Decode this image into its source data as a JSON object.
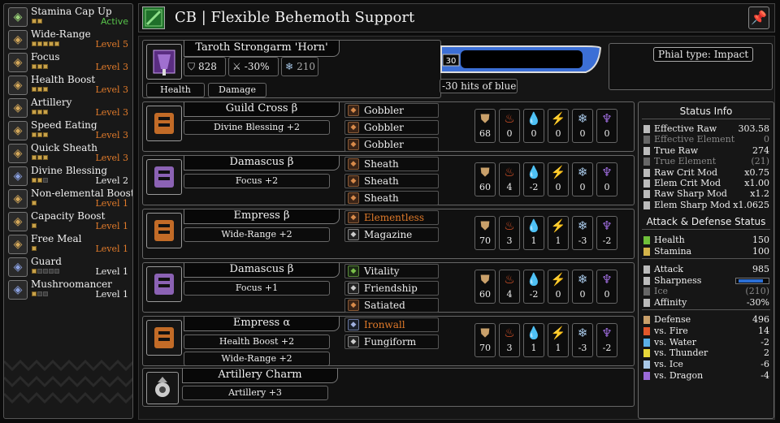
{
  "header": {
    "title": "CB | Flexible Behemoth Support",
    "pin_icon": "pin-icon"
  },
  "skills": [
    {
      "name": "Stamina Cap Up",
      "level": "Active",
      "pips": 2,
      "max": 2,
      "color": "green",
      "icon": "stamina-icon"
    },
    {
      "name": "Wide-Range",
      "level": "Level 5",
      "pips": 5,
      "max": 5,
      "color": "orange",
      "icon": "wide-range-icon"
    },
    {
      "name": "Focus",
      "level": "Level 3",
      "pips": 3,
      "max": 3,
      "color": "orange",
      "icon": "focus-icon"
    },
    {
      "name": "Health Boost",
      "level": "Level 3",
      "pips": 3,
      "max": 3,
      "color": "orange",
      "icon": "health-boost-icon"
    },
    {
      "name": "Artillery",
      "level": "Level 3",
      "pips": 3,
      "max": 3,
      "color": "orange",
      "icon": "artillery-icon"
    },
    {
      "name": "Speed Eating",
      "level": "Level 3",
      "pips": 3,
      "max": 3,
      "color": "orange",
      "icon": "speed-eating-icon"
    },
    {
      "name": "Quick Sheath",
      "level": "Level 3",
      "pips": 3,
      "max": 3,
      "color": "orange",
      "icon": "quick-sheath-icon"
    },
    {
      "name": "Divine Blessing",
      "level": "Level 2",
      "pips": 2,
      "max": 3,
      "color": "white",
      "icon": "divine-blessing-icon"
    },
    {
      "name": "Non-elemental Boost",
      "level": "Level 1",
      "pips": 1,
      "max": 1,
      "color": "orange",
      "icon": "non-elemental-boost-icon"
    },
    {
      "name": "Capacity Boost",
      "level": "Level 1",
      "pips": 1,
      "max": 1,
      "color": "orange",
      "icon": "capacity-boost-icon"
    },
    {
      "name": "Free Meal",
      "level": "Level 1",
      "pips": 1,
      "max": 1,
      "color": "orange",
      "icon": "free-meal-icon"
    },
    {
      "name": "Guard",
      "level": "Level 1",
      "pips": 1,
      "max": 5,
      "color": "white",
      "icon": "guard-icon"
    },
    {
      "name": "Mushroomancer",
      "level": "Level 1",
      "pips": 1,
      "max": 3,
      "color": "white",
      "icon": "mushroomancer-icon"
    }
  ],
  "weapon": {
    "name": "Taroth Strongarm 'Horn'",
    "attack": "828",
    "affinity": "-30%",
    "element": "210",
    "buttons": {
      "health": "Health",
      "damage": "Damage"
    },
    "sharpness_level": "30",
    "hits_label": "-30 hits of blue",
    "phial": "Phial type: Impact",
    "sharpness_color": "#2b6fd6"
  },
  "armor": [
    {
      "name": "Guild Cross β",
      "skills": [
        "Divine Blessing +2"
      ],
      "decos": [
        {
          "label": "Gobbler",
          "tone": "orange",
          "highlight": false
        },
        {
          "label": "Gobbler",
          "tone": "orange",
          "highlight": false
        },
        {
          "label": "Gobbler",
          "tone": "orange",
          "highlight": false
        }
      ],
      "res": [
        "68",
        "0",
        "0",
        "0",
        "0",
        "0"
      ]
    },
    {
      "name": "Damascus β",
      "skills": [
        "Focus +2"
      ],
      "decos": [
        {
          "label": "Sheath",
          "tone": "orange",
          "highlight": false
        },
        {
          "label": "Sheath",
          "tone": "orange",
          "highlight": false
        },
        {
          "label": "Sheath",
          "tone": "orange",
          "highlight": false
        }
      ],
      "res": [
        "60",
        "4",
        "-2",
        "0",
        "0",
        "0"
      ]
    },
    {
      "name": "Empress β",
      "skills": [
        "Wide-Range +2"
      ],
      "decos": [
        {
          "label": "Elementless",
          "tone": "orange",
          "highlight": true
        },
        {
          "label": "Magazine",
          "tone": "grey",
          "highlight": false
        }
      ],
      "res": [
        "70",
        "3",
        "1",
        "1",
        "-3",
        "-2"
      ]
    },
    {
      "name": "Damascus β",
      "skills": [
        "Focus +1"
      ],
      "decos": [
        {
          "label": "Vitality",
          "tone": "green",
          "highlight": false
        },
        {
          "label": "Friendship",
          "tone": "grey",
          "highlight": false
        },
        {
          "label": "Satiated",
          "tone": "orange",
          "highlight": false
        }
      ],
      "res": [
        "60",
        "4",
        "-2",
        "0",
        "0",
        "0"
      ]
    },
    {
      "name": "Empress α",
      "skills": [
        "Health Boost +2",
        "Wide-Range +2"
      ],
      "decos": [
        {
          "label": "Ironwall",
          "tone": "blue",
          "highlight": true
        },
        {
          "label": "Fungiform",
          "tone": "grey",
          "highlight": false
        }
      ],
      "res": [
        "70",
        "3",
        "1",
        "1",
        "-3",
        "-2"
      ]
    }
  ],
  "charm": {
    "name": "Artillery Charm",
    "skills": [
      "Artillery +3"
    ]
  },
  "status": {
    "title": "Status Info",
    "rows": [
      {
        "label": "Effective Raw",
        "value": "303.58",
        "dim": false
      },
      {
        "label": "Effective Element",
        "value": "0",
        "dim": true
      },
      {
        "label": "True Raw",
        "value": "274",
        "dim": false
      },
      {
        "label": "True Element",
        "value": "(21)",
        "dim": true
      },
      {
        "label": "Raw Crit Mod",
        "value": "x0.75",
        "dim": false
      },
      {
        "label": "Elem Crit Mod",
        "value": "x1.00",
        "dim": false
      },
      {
        "label": "Raw Sharp Mod",
        "value": "x1.2",
        "dim": false
      },
      {
        "label": "Elem Sharp Mod",
        "value": "x1.0625",
        "dim": false
      }
    ],
    "ad_title": "Attack & Defense Status",
    "vitals": [
      {
        "label": "Health",
        "value": "150",
        "color": "#6fbf3a"
      },
      {
        "label": "Stamina",
        "value": "100",
        "color": "#d4b44a"
      }
    ],
    "attack_rows": [
      {
        "label": "Attack",
        "value": "985",
        "dim": false
      },
      {
        "label": "Sharpness",
        "value": "",
        "dim": false
      },
      {
        "label": "Ice",
        "value": "(210)",
        "dim": true
      },
      {
        "label": "Affinity",
        "value": "-30%",
        "dim": false
      }
    ],
    "defense_rows": [
      {
        "label": "Defense",
        "value": "496",
        "color": "#c9a06a"
      },
      {
        "label": "vs. Fire",
        "value": "14",
        "color": "#e2572a"
      },
      {
        "label": "vs. Water",
        "value": "-2",
        "color": "#5ab0e8"
      },
      {
        "label": "vs. Thunder",
        "value": "2",
        "color": "#e8d83a"
      },
      {
        "label": "vs. Ice",
        "value": "-6",
        "color": "#a8c8e8"
      },
      {
        "label": "vs. Dragon",
        "value": "-4",
        "color": "#9a6ad8"
      }
    ]
  },
  "res_icons": [
    {
      "name": "defense-icon",
      "glyph": "⛊",
      "color": "#c9a06a"
    },
    {
      "name": "fire-icon",
      "glyph": "♨",
      "color": "#e2572a"
    },
    {
      "name": "water-icon",
      "glyph": "💧",
      "color": "#5ab0e8"
    },
    {
      "name": "thunder-icon",
      "glyph": "⚡",
      "color": "#e8d83a"
    },
    {
      "name": "ice-icon",
      "glyph": "❄",
      "color": "#a8c8e8"
    },
    {
      "name": "dragon-icon",
      "glyph": "♆",
      "color": "#9a6ad8"
    }
  ]
}
